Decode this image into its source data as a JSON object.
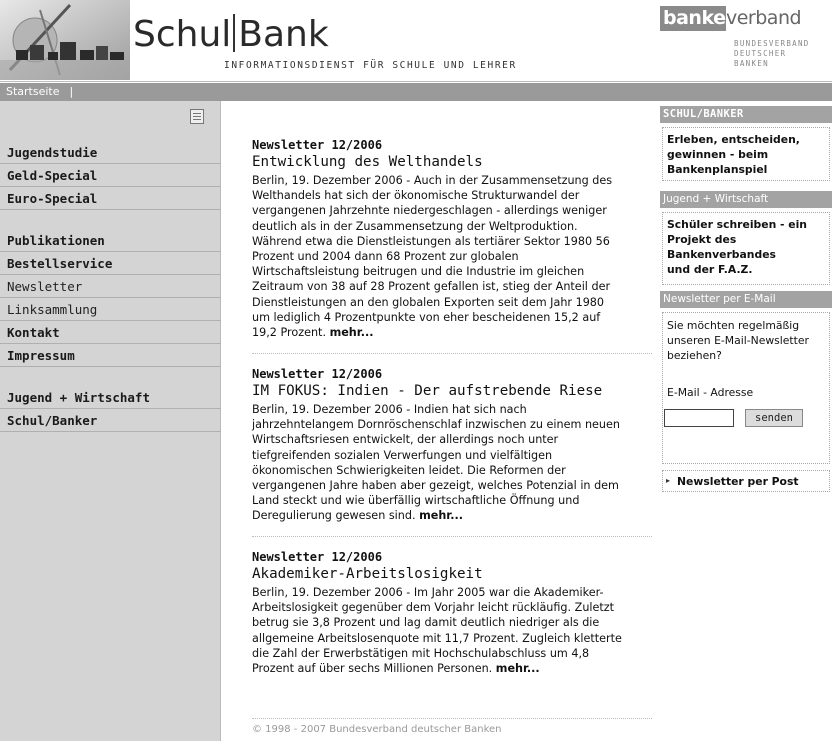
{
  "header": {
    "title_left": "Schul",
    "title_right": "Bank",
    "subtitle": "INFORMATIONSDIENST FÜR SCHULE UND LEHRER",
    "partner_logo": {
      "boxed": "banken",
      "rest": "verband",
      "line1": "BUNDESVERBAND",
      "line2": "DEUTSCHER",
      "line3": "BANKEN"
    }
  },
  "navbar": {
    "home": "Startseite",
    "separator": "|"
  },
  "sidebar": {
    "print_icon": "document-list-icon",
    "items": [
      {
        "label": "Jugendstudie",
        "bold": true
      },
      {
        "label": "Geld-Special",
        "bold": true
      },
      {
        "label": "Euro-Special",
        "bold": true
      },
      {
        "label": "Publikationen",
        "bold": true
      },
      {
        "label": "Bestellservice",
        "bold": true
      },
      {
        "label": "Newsletter",
        "bold": false
      },
      {
        "label": "Linksammlung",
        "bold": false
      },
      {
        "label": "Kontakt",
        "bold": true
      },
      {
        "label": "Impressum",
        "bold": true
      },
      {
        "label": "Jugend + Wirtschaft",
        "bold": true
      },
      {
        "label": "Schul/Banker",
        "bold": true
      }
    ]
  },
  "articles": [
    {
      "issue": "Newsletter 12/2006",
      "headline": "Entwicklung des Welthandels",
      "body": "Berlin, 19. Dezember 2006 - Auch in der Zusammensetzung des\nWelthandels hat sich der ökonomische Strukturwandel der\nvergangenen Jahrzehnte niedergeschlagen - allerdings weniger\ndeutlich als in der Zusammensetzung der Weltproduktion.\nWährend etwa die Dienstleistungen als tertiärer Sektor 1980 56\nProzent und 2004 dann 68 Prozent zur globalen\nWirtschaftsleistung beitrugen und die Industrie im gleichen\nZeitraum von 38 auf 28 Prozent gefallen ist, stieg der Anteil der\nDienstleistungen an den globalen Exporten seit dem Jahr 1980\num lediglich 4 Prozentpunkte von eher bescheidenen 15,2 auf\n19,2 Prozent. ",
      "more": "mehr..."
    },
    {
      "issue": "Newsletter 12/2006",
      "headline": "IM FOKUS: Indien - Der aufstrebende Riese",
      "body": "Berlin, 19. Dezember 2006 - Indien hat sich nach\njahrzehntelangem Dornröschenschlaf inzwischen zu einem neuen\nWirtschaftsriesen entwickelt, der allerdings noch unter\ntiefgreifenden sozialen Verwerfungen und vielfältigen\nökonomischen Schwierigkeiten leidet. Die Reformen der\nvergangenen Jahre haben aber gezeigt, welches Potenzial in dem\nLand steckt und wie überfällig wirtschaftliche Öffnung und\nDeregulierung gewesen sind. ",
      "more": "mehr..."
    },
    {
      "issue": "Newsletter 12/2006",
      "headline": "Akademiker-Arbeitslosigkeit",
      "body": "Berlin, 19. Dezember 2006 - Im Jahr 2005 war die Akademiker-\nArbeitslosigkeit gegenüber dem Vorjahr leicht rückläufig. Zuletzt\nbetrug sie 3,8 Prozent und lag damit deutlich niedriger als die\nallgemeine Arbeitslosenquote mit 11,7 Prozent. Zugleich kletterte\ndie Zahl der Erwerbstätigen mit Hochschulabschluss um 4,8\nProzent auf über sechs Millionen Personen. ",
      "more": "mehr..."
    }
  ],
  "footer": {
    "copyright": "© 1998 - 2007 Bundesverband deutscher Banken"
  },
  "right_column": {
    "box1_header": "SCHUL/BANKER",
    "box1_text": "Erleben, entscheiden,\ngewinnen - beim\nBankenplanspiel",
    "box2_header": "Jugend + Wirtschaft",
    "box2_text": "Schüler schreiben - ein\nProjekt des\nBankenverbandes\nund der F.A.Z.",
    "box3_header": "Newsletter per E-Mail",
    "box3_text": "Sie möchten regelmäßig\nunseren E-Mail-Newsletter\nbeziehen?",
    "email_label": "E-Mail - Adresse",
    "email_value": "",
    "send_label": "senden",
    "post_link": "Newsletter per Post",
    "post_icon": "triangle-right-icon"
  }
}
